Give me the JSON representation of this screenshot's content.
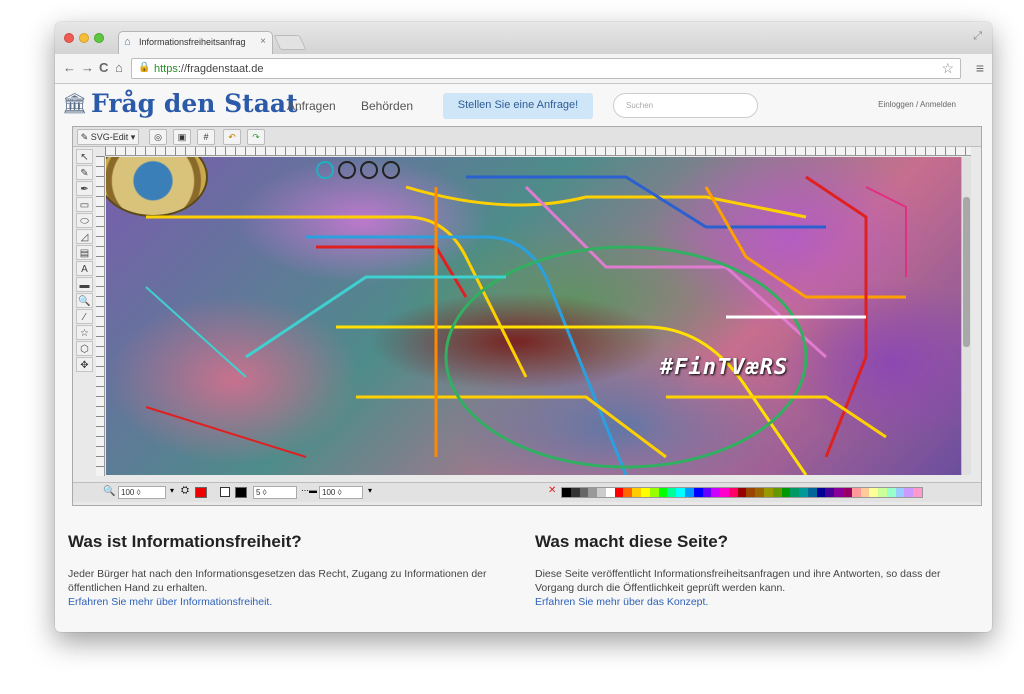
{
  "browser": {
    "tab_title": "Informationsfreiheitsanfrag",
    "tab_close": "×",
    "url_scheme": "https",
    "url_rest": "://fragdenstaat.de",
    "back": "←",
    "forward": "→",
    "reload": "C",
    "home": "⌂",
    "star": "☆",
    "menu": "≡"
  },
  "site": {
    "logo": "Fråg den Staat",
    "nav": [
      "Anfragen",
      "Behörden"
    ],
    "cta": "Stellen Sie eine Anfrage!",
    "search_placeholder": "Suchen",
    "login": "Einloggen / Anmelden"
  },
  "editor": {
    "mode_label": "SVG-Edit ▾",
    "hashtag": "#FinTVæRS",
    "zoom": "100",
    "stroke_width": "5",
    "opacity": "100",
    "tools": [
      "↖",
      "✎",
      "✒",
      "▭",
      "⬭",
      "◿",
      "▤",
      "A",
      "▬",
      "🔍",
      "⁄",
      "☆",
      "⬡",
      "✥"
    ],
    "palette_colors": [
      "#000000",
      "#333333",
      "#666666",
      "#999999",
      "#cccccc",
      "#ffffff",
      "#ff0000",
      "#ff6600",
      "#ffcc00",
      "#ffff00",
      "#99ff00",
      "#00ff00",
      "#00ff99",
      "#00ffff",
      "#0099ff",
      "#0000ff",
      "#6600ff",
      "#cc00ff",
      "#ff00cc",
      "#ff0066",
      "#990000",
      "#994400",
      "#996600",
      "#999900",
      "#669900",
      "#009900",
      "#009966",
      "#009999",
      "#006699",
      "#000099",
      "#440099",
      "#880099",
      "#990066",
      "#ff9999",
      "#ffcc99",
      "#ffff99",
      "#ccff99",
      "#99ffcc",
      "#99ccff",
      "#cc99ff",
      "#ff99cc"
    ]
  },
  "sections": [
    {
      "heading": "Was ist Informationsfreiheit?",
      "text": "Jeder Bürger hat nach den Informationsgesetzen das Recht, Zugang zu Informationen der öffentlichen Hand zu erhalten.",
      "link": "Erfahren Sie mehr über Informationsfreiheit."
    },
    {
      "heading": "Was macht diese Seite?",
      "text": "Diese Seite veröffentlicht Informationsfreiheitsanfragen und ihre Antworten, so dass der Vorgang durch die Öffentlichkeit geprüft werden kann.",
      "link": "Erfahren Sie mehr über das Konzept."
    }
  ]
}
